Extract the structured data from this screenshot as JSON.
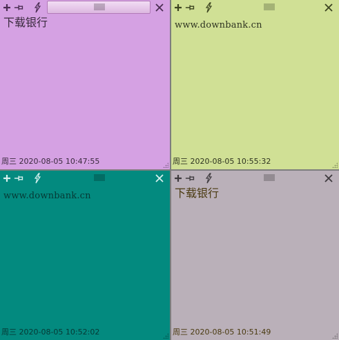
{
  "notes": [
    {
      "id": "note1",
      "bg": "#d5a1e3",
      "title_value": "",
      "content": "下载银行",
      "footer": "周三 2020-08-05 10:47:55",
      "text_color": "#3a2a3e",
      "icon_color": "#4a2d52"
    },
    {
      "id": "note2",
      "bg": "#d0e095",
      "content": "www.downbank.cn",
      "footer": "周三 2020-08-05 10:55:32",
      "text_color": "#2e3320",
      "icon_color": "#3c4420"
    },
    {
      "id": "note3",
      "bg": "#038a7f",
      "content": "www.downbank.cn",
      "footer": "周三 2020-08-05 10:52:02",
      "text_color": "#063834",
      "icon_color": "#d6f0ee"
    },
    {
      "id": "note4",
      "bg": "#bab0b9",
      "content": "下载银行",
      "footer": "周三 2020-08-05 10:51:49",
      "text_color": "#4a3a10",
      "icon_color": "#3e3a3e"
    }
  ],
  "icons": {
    "add": "plus-icon",
    "pin": "pin-icon",
    "bolt": "lightning-icon",
    "close": "close-icon",
    "grip": "drag-grip",
    "resize": "resize-grip"
  }
}
